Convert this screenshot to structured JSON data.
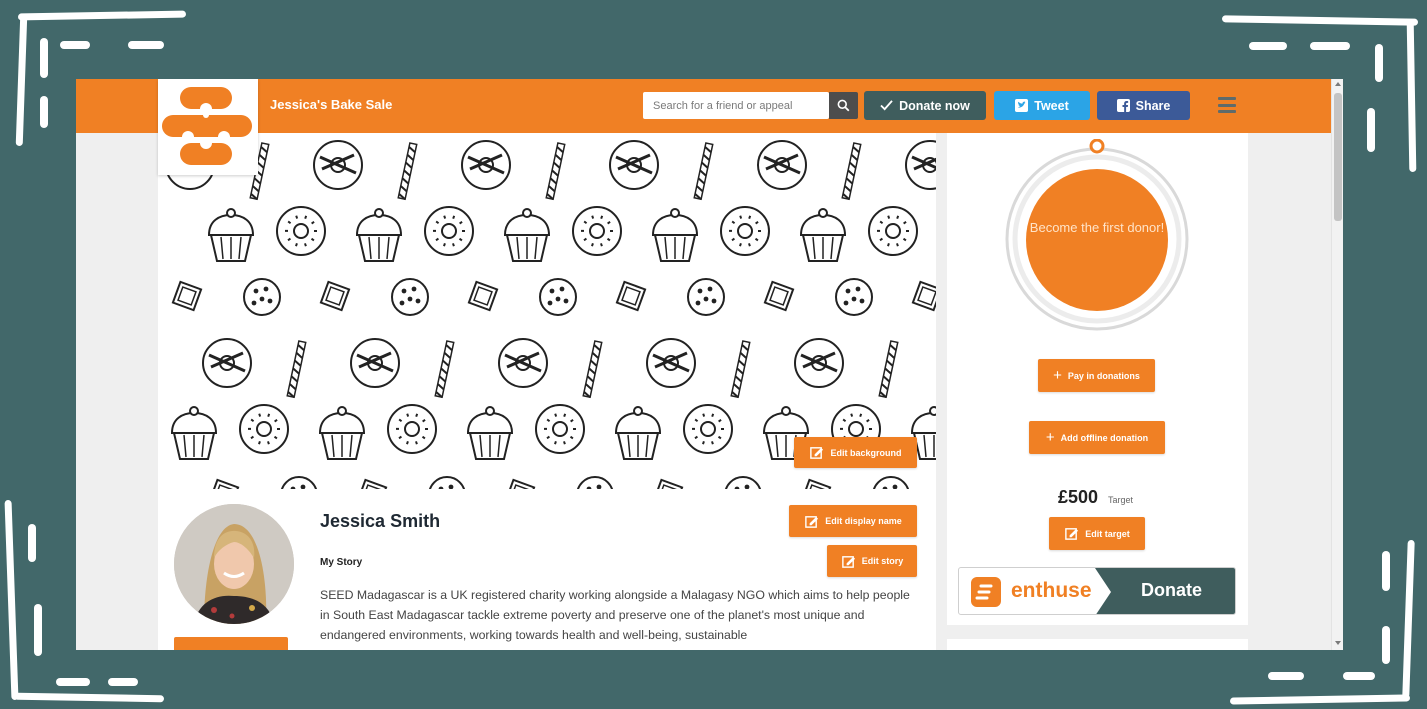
{
  "header": {
    "site_title": "Jessica's Bake Sale",
    "search_placeholder": "Search for a friend or appeal",
    "donate_now_label": "Donate now",
    "tweet_label": "Tweet",
    "share_label": "Share"
  },
  "banner": {
    "edit_background_label": "Edit background"
  },
  "profile": {
    "name": "Jessica Smith",
    "edit_display_name_label": "Edit display name",
    "story_heading": "My Story",
    "edit_story_label": "Edit story",
    "story_text": "SEED Madagascar is a UK registered charity working alongside a Malagasy NGO which aims to help people in South East Madagascar tackle extreme poverty and preserve one of the planet's most unique and endangered environments, working towards health and well-being, sustainable"
  },
  "sidebar": {
    "donor_circle_text": "Become the first donor!",
    "pay_in_label": "Pay in donations",
    "add_offline_label": "Add offline donation",
    "target_amount": "£500",
    "target_label": "Target",
    "edit_target_label": "Edit target",
    "enthuse_brand": "enthuse",
    "enthuse_donate_label": "Donate"
  },
  "colors": {
    "frame_bg": "#42686a",
    "brand_orange": "#f08024",
    "donate_now_bg": "#3f5d5d",
    "tweet_bg": "#2ba4e6",
    "share_bg": "#3c5a98",
    "enthuse_dark": "#3f5d5d"
  },
  "icons": {
    "search": "search-icon",
    "check": "check-icon",
    "twitter": "twitter-icon",
    "facebook": "facebook-icon",
    "menu": "hamburger-menu-icon",
    "edit": "edit-icon",
    "plus": "plus-icon"
  }
}
